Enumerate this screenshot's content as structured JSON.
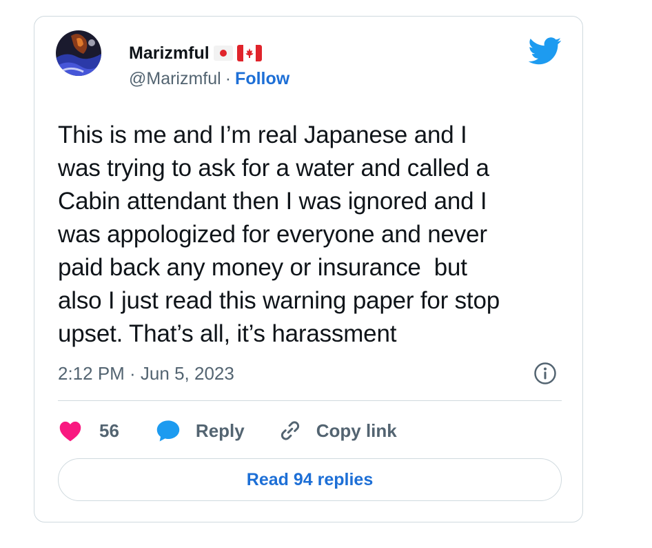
{
  "author": {
    "display_name": "Marizmful",
    "handle": "@Marizmful",
    "separator": "·",
    "follow_label": "Follow",
    "badges": [
      "japan-flag",
      "canada-flag"
    ]
  },
  "tweet": {
    "text": "This is me and I’m real Japanese and I\nwas trying to ask for a water and called a\nCabin attendant then I was ignored and I\nwas appologized for everyone and never\npaid back any money or insurance  but\nalso I just read this warning paper for stop\nupset. That’s all, it’s harassment",
    "timestamp": "2:12 PM · Jun 5, 2023"
  },
  "actions": {
    "like_count": "56",
    "reply_label": "Reply",
    "copy_link_label": "Copy link",
    "read_replies_label": "Read 94 replies"
  },
  "icons": {
    "brand": "twitter-bird-icon",
    "info": "info-icon",
    "like": "heart-icon",
    "reply": "speech-bubble-icon",
    "copy": "link-icon"
  },
  "colors": {
    "brand_blue": "#1d9bf0",
    "link_blue": "#1d6fd6",
    "heart": "#f91880",
    "muted_text": "#536471",
    "border": "#cfd9de"
  }
}
